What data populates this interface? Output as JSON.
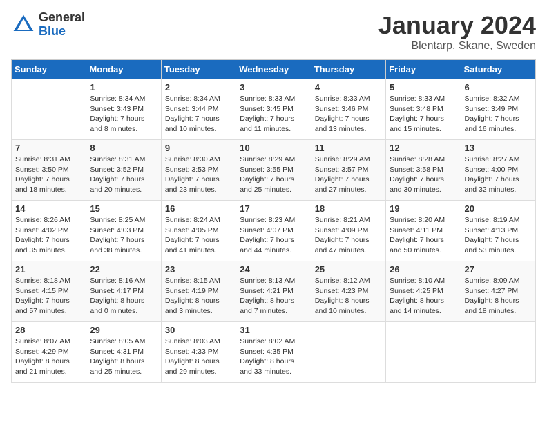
{
  "header": {
    "logo_general": "General",
    "logo_blue": "Blue",
    "month_title": "January 2024",
    "location": "Blentarp, Skane, Sweden"
  },
  "days_of_week": [
    "Sunday",
    "Monday",
    "Tuesday",
    "Wednesday",
    "Thursday",
    "Friday",
    "Saturday"
  ],
  "weeks": [
    [
      {
        "day": "",
        "info": ""
      },
      {
        "day": "1",
        "info": "Sunrise: 8:34 AM\nSunset: 3:43 PM\nDaylight: 7 hours\nand 8 minutes."
      },
      {
        "day": "2",
        "info": "Sunrise: 8:34 AM\nSunset: 3:44 PM\nDaylight: 7 hours\nand 10 minutes."
      },
      {
        "day": "3",
        "info": "Sunrise: 8:33 AM\nSunset: 3:45 PM\nDaylight: 7 hours\nand 11 minutes."
      },
      {
        "day": "4",
        "info": "Sunrise: 8:33 AM\nSunset: 3:46 PM\nDaylight: 7 hours\nand 13 minutes."
      },
      {
        "day": "5",
        "info": "Sunrise: 8:33 AM\nSunset: 3:48 PM\nDaylight: 7 hours\nand 15 minutes."
      },
      {
        "day": "6",
        "info": "Sunrise: 8:32 AM\nSunset: 3:49 PM\nDaylight: 7 hours\nand 16 minutes."
      }
    ],
    [
      {
        "day": "7",
        "info": "Sunrise: 8:31 AM\nSunset: 3:50 PM\nDaylight: 7 hours\nand 18 minutes."
      },
      {
        "day": "8",
        "info": "Sunrise: 8:31 AM\nSunset: 3:52 PM\nDaylight: 7 hours\nand 20 minutes."
      },
      {
        "day": "9",
        "info": "Sunrise: 8:30 AM\nSunset: 3:53 PM\nDaylight: 7 hours\nand 23 minutes."
      },
      {
        "day": "10",
        "info": "Sunrise: 8:29 AM\nSunset: 3:55 PM\nDaylight: 7 hours\nand 25 minutes."
      },
      {
        "day": "11",
        "info": "Sunrise: 8:29 AM\nSunset: 3:57 PM\nDaylight: 7 hours\nand 27 minutes."
      },
      {
        "day": "12",
        "info": "Sunrise: 8:28 AM\nSunset: 3:58 PM\nDaylight: 7 hours\nand 30 minutes."
      },
      {
        "day": "13",
        "info": "Sunrise: 8:27 AM\nSunset: 4:00 PM\nDaylight: 7 hours\nand 32 minutes."
      }
    ],
    [
      {
        "day": "14",
        "info": "Sunrise: 8:26 AM\nSunset: 4:02 PM\nDaylight: 7 hours\nand 35 minutes."
      },
      {
        "day": "15",
        "info": "Sunrise: 8:25 AM\nSunset: 4:03 PM\nDaylight: 7 hours\nand 38 minutes."
      },
      {
        "day": "16",
        "info": "Sunrise: 8:24 AM\nSunset: 4:05 PM\nDaylight: 7 hours\nand 41 minutes."
      },
      {
        "day": "17",
        "info": "Sunrise: 8:23 AM\nSunset: 4:07 PM\nDaylight: 7 hours\nand 44 minutes."
      },
      {
        "day": "18",
        "info": "Sunrise: 8:21 AM\nSunset: 4:09 PM\nDaylight: 7 hours\nand 47 minutes."
      },
      {
        "day": "19",
        "info": "Sunrise: 8:20 AM\nSunset: 4:11 PM\nDaylight: 7 hours\nand 50 minutes."
      },
      {
        "day": "20",
        "info": "Sunrise: 8:19 AM\nSunset: 4:13 PM\nDaylight: 7 hours\nand 53 minutes."
      }
    ],
    [
      {
        "day": "21",
        "info": "Sunrise: 8:18 AM\nSunset: 4:15 PM\nDaylight: 7 hours\nand 57 minutes."
      },
      {
        "day": "22",
        "info": "Sunrise: 8:16 AM\nSunset: 4:17 PM\nDaylight: 8 hours\nand 0 minutes."
      },
      {
        "day": "23",
        "info": "Sunrise: 8:15 AM\nSunset: 4:19 PM\nDaylight: 8 hours\nand 3 minutes."
      },
      {
        "day": "24",
        "info": "Sunrise: 8:13 AM\nSunset: 4:21 PM\nDaylight: 8 hours\nand 7 minutes."
      },
      {
        "day": "25",
        "info": "Sunrise: 8:12 AM\nSunset: 4:23 PM\nDaylight: 8 hours\nand 10 minutes."
      },
      {
        "day": "26",
        "info": "Sunrise: 8:10 AM\nSunset: 4:25 PM\nDaylight: 8 hours\nand 14 minutes."
      },
      {
        "day": "27",
        "info": "Sunrise: 8:09 AM\nSunset: 4:27 PM\nDaylight: 8 hours\nand 18 minutes."
      }
    ],
    [
      {
        "day": "28",
        "info": "Sunrise: 8:07 AM\nSunset: 4:29 PM\nDaylight: 8 hours\nand 21 minutes."
      },
      {
        "day": "29",
        "info": "Sunrise: 8:05 AM\nSunset: 4:31 PM\nDaylight: 8 hours\nand 25 minutes."
      },
      {
        "day": "30",
        "info": "Sunrise: 8:03 AM\nSunset: 4:33 PM\nDaylight: 8 hours\nand 29 minutes."
      },
      {
        "day": "31",
        "info": "Sunrise: 8:02 AM\nSunset: 4:35 PM\nDaylight: 8 hours\nand 33 minutes."
      },
      {
        "day": "",
        "info": ""
      },
      {
        "day": "",
        "info": ""
      },
      {
        "day": "",
        "info": ""
      }
    ]
  ]
}
